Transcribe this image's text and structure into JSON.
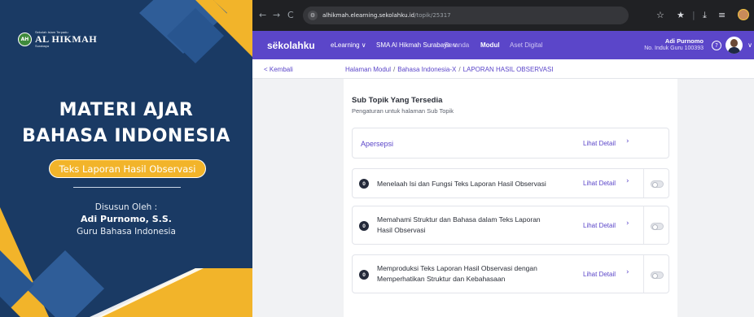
{
  "cover": {
    "logo": {
      "mark": "AH",
      "small_text": "Sekolah Islam Terpadu",
      "name": "AL HIKMAH",
      "sub_text": "Surabaya"
    },
    "title_line1": "MATERI AJAR",
    "title_line2": "BAHASA INDONESIA",
    "subtitle": "Teks Laporan Hasil Observasi",
    "by_label": "Disusun Oleh :",
    "author": "Adi Purnomo, S.S.",
    "role": "Guru Bahasa Indonesia",
    "colors": {
      "navy": "#1a3a64",
      "gold": "#f2b42a",
      "mid_blue": "#28558f"
    }
  },
  "browser": {
    "nav": {
      "back": "←",
      "forward": "→",
      "reload": "C"
    },
    "url": {
      "host": "alhikmah.elearning.sekolahku.id",
      "path": "/topik/25317"
    },
    "toolbar_icons": [
      "star-icon",
      "extension-icon",
      "download-icon",
      "menu-icon"
    ]
  },
  "app": {
    "brand": "sëkolahku",
    "menu": {
      "elearning": "eLearning ∨",
      "school": "SMA Al Hikmah Surabaya ∨",
      "beranda": "Beranda",
      "modul": "Modul",
      "aset": "Aset Digital"
    },
    "user": {
      "name": "Adi Purnomo",
      "id_line": "No. Induk Guru 100393"
    },
    "help": "?",
    "accent": "#5b46c9"
  },
  "subbar": {
    "back_label": "< Kembali",
    "breadcrumb": {
      "item1": "Halaman Modul",
      "item2": "Bahasa Indonesia-X",
      "item3": "LAPORAN HASIL OBSERVASI",
      "sep": "/"
    }
  },
  "main": {
    "title": "Sub Topik Yang Tersedia",
    "subtitle": "Pengaturan untuk halaman Sub Topik",
    "apersepsi": {
      "title": "Apersepsi",
      "link": "Lihat Detail",
      "chevron": "›"
    },
    "items": [
      {
        "number": "0",
        "text": "Menelaah Isi dan Fungsi Teks Laporan Hasil Observasi",
        "link": "Lihat Detail",
        "chevron": "›",
        "enabled": false
      },
      {
        "number": "0",
        "text": "Memahami Struktur dan Bahasa dalam Teks Laporan Hasil Observasi",
        "link": "Lihat Detail",
        "chevron": "›",
        "enabled": false
      },
      {
        "number": "0",
        "text": "Memproduksi Teks Laporan Hasil Observasi dengan Memperhatikan Struktur dan Kebahasaan",
        "link": "Lihat Detail",
        "chevron": "›",
        "enabled": false
      }
    ]
  }
}
